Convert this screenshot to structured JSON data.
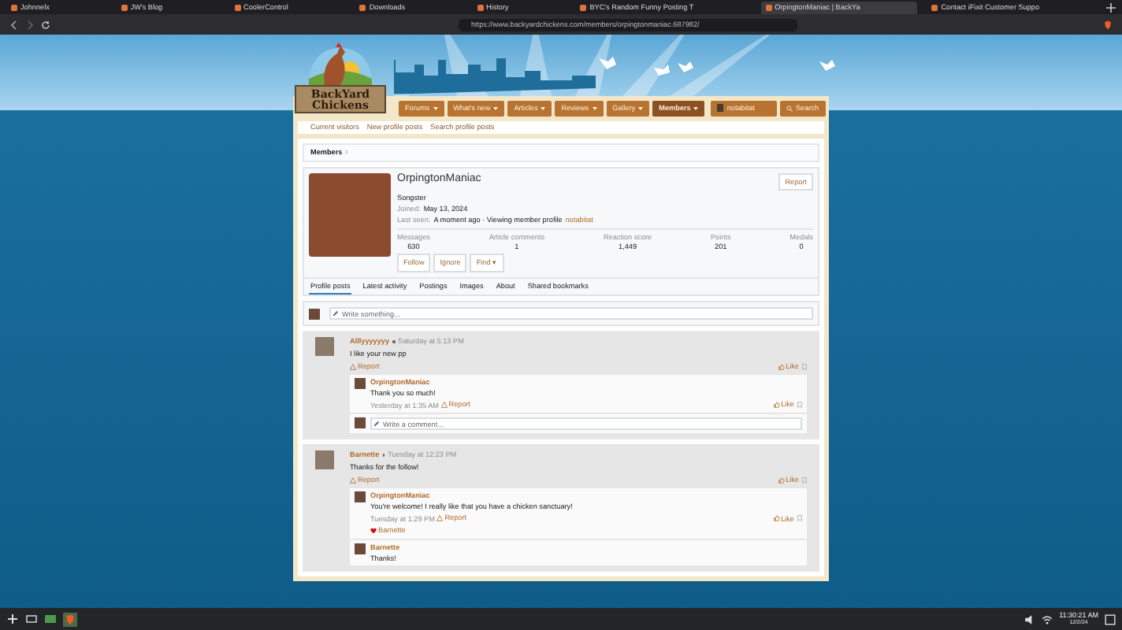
{
  "browser": {
    "tabs": [
      {
        "title": "Johnnelx",
        "selected": false
      },
      {
        "title": "JW's Blog",
        "selected": false
      },
      {
        "title": "CoolerControl",
        "selected": false
      },
      {
        "title": "Downloads",
        "selected": false
      },
      {
        "title": "History",
        "selected": false
      },
      {
        "title": "BYC's Random Funny Posting T",
        "selected": false
      },
      {
        "title": "OrpingtonManiac | BackYa",
        "selected": true
      },
      {
        "title": "Contact iFixit Customer Suppo",
        "selected": false
      }
    ],
    "url": "https://www.backyardchickens.com/members/orpingtonmaniac.687982/"
  },
  "site": {
    "logo_text": "BackYard Chickens",
    "nav": [
      {
        "label": "Forums",
        "selected": false
      },
      {
        "label": "What's new",
        "selected": false
      },
      {
        "label": "Articles",
        "selected": false
      },
      {
        "label": "Reviews",
        "selected": false
      },
      {
        "label": "Gallery",
        "selected": false
      },
      {
        "label": "Members",
        "selected": true
      }
    ],
    "user": "notabitat",
    "search": "Search",
    "subnav": [
      "Current visitors",
      "New profile posts",
      "Search profile posts"
    ]
  },
  "breadcrumb": "Members",
  "profile": {
    "name": "OrpingtonManiac",
    "rank": "Songster",
    "joined_label": "Joined:",
    "joined": "May 13, 2024",
    "last_seen_label": "Last seen:",
    "last_seen": "A moment ago · Viewing member profile",
    "viewer": "notabitat",
    "report": "Report",
    "stats": [
      {
        "label": "Messages",
        "value": "630"
      },
      {
        "label": "Article comments",
        "value": "1"
      },
      {
        "label": "Reaction score",
        "value": "1,449"
      },
      {
        "label": "Points",
        "value": "201"
      },
      {
        "label": "Medals",
        "value": "0"
      }
    ],
    "buttons": [
      "Follow",
      "Ignore",
      "Find ▾"
    ],
    "tabs": [
      {
        "label": "Profile posts",
        "selected": true
      },
      {
        "label": "Latest activity",
        "selected": false
      },
      {
        "label": "Postings",
        "selected": false
      },
      {
        "label": "Images",
        "selected": false
      },
      {
        "label": "About",
        "selected": false
      },
      {
        "label": "Shared bookmarks",
        "selected": false
      }
    ]
  },
  "composer": {
    "placeholder": "Write something..."
  },
  "posts": [
    {
      "author": "Alllyyyyyyy",
      "time": "Saturday at 5:13 PM",
      "text": "I like your new pp",
      "report": "Report",
      "like": "Like",
      "comments": [
        {
          "author": "OrpingtonManiac",
          "text": "Thank you so much!",
          "time": "Yesterday at 1:35 AM",
          "report": "Report",
          "like": "Like"
        }
      ],
      "comment_placeholder": "Write a comment..."
    },
    {
      "author": "Barnette",
      "time": "Tuesday at 12:23 PM",
      "text": "Thanks for the follow!",
      "report": "Report",
      "like": "Like",
      "comments": [
        {
          "author": "OrpingtonManiac",
          "text": "You're welcome! I really like that you have a chicken sanctuary!",
          "time": "Tuesday at 1:29 PM",
          "report": "Report",
          "like": "Like",
          "reaction": "Barnette"
        },
        {
          "author": "Barnette",
          "text": "Thanks!"
        }
      ]
    }
  ],
  "taskbar": {
    "time": "11:30:21 AM",
    "date": "12/2/24"
  }
}
